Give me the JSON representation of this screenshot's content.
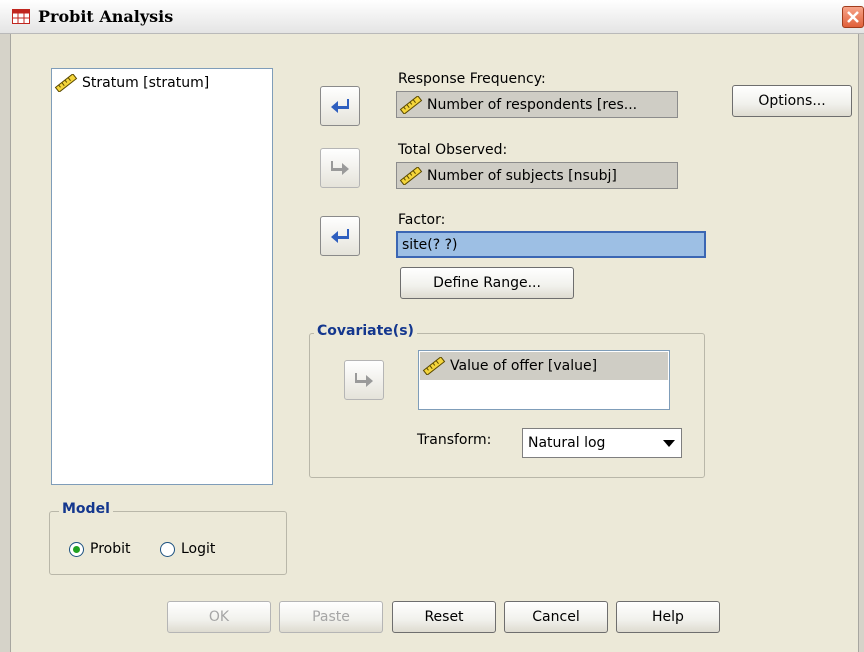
{
  "window": {
    "title": "Probit Analysis"
  },
  "variables": [
    {
      "label": "Stratum [stratum]",
      "icon": "ruler-scale-icon"
    }
  ],
  "response_frequency": {
    "label": "Response Frequency:",
    "value": "Number of respondents [res..."
  },
  "total_observed": {
    "label": "Total Observed:",
    "value": "Number of subjects [nsubj]"
  },
  "factor": {
    "label": "Factor:",
    "value": "site(? ?)",
    "define_range_label": "Define Range..."
  },
  "covariates": {
    "legend": "Covariate(s)",
    "items": [
      "Value of offer [value]"
    ],
    "transform_label": "Transform:",
    "transform_value": "Natural log"
  },
  "options_label": "Options...",
  "model": {
    "legend": "Model",
    "options": [
      "Probit",
      "Logit"
    ],
    "selected": "Probit"
  },
  "buttons": {
    "ok": "OK",
    "paste": "Paste",
    "reset": "Reset",
    "cancel": "Cancel",
    "help": "Help"
  },
  "colors": {
    "dialog_bg": "#ece9d8",
    "selection": "#9dbfe4",
    "group_legend": "#14378e",
    "arrow_blue": "#2f5fbf"
  }
}
